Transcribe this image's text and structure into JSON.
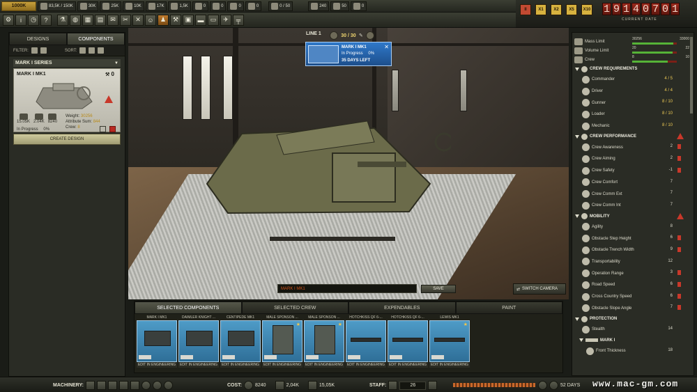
{
  "topbar": {
    "money": "1000K",
    "resources": [
      {
        "icon": "crate-icon",
        "value": "83,5K / 150K"
      },
      {
        "icon": "steel-icon",
        "value": "30K"
      },
      {
        "icon": "wood-icon",
        "value": "25K"
      },
      {
        "icon": "rubber-icon",
        "value": "10K"
      },
      {
        "icon": "oil-icon",
        "value": "17K"
      },
      {
        "icon": "coal-icon",
        "value": "1,5K"
      },
      {
        "icon": "tools-icon",
        "value": "0"
      },
      {
        "icon": "bullet-icon",
        "value": "0"
      },
      {
        "icon": "shell-icon",
        "value": "0"
      },
      {
        "icon": "fuel-icon",
        "value": "0"
      }
    ],
    "capacity": "0 / 50",
    "workers": [
      {
        "icon": "worker-icon",
        "value": "240"
      },
      {
        "icon": "engineer-icon",
        "value": "50"
      },
      {
        "icon": "pilot-icon",
        "value": "0"
      }
    ]
  },
  "date": {
    "digits": [
      "1",
      "9",
      "1",
      "4",
      "0",
      "7",
      "0",
      "1"
    ],
    "label": "CURRENT DATE",
    "speeds": [
      "II",
      "X1",
      "X2",
      "X5",
      "X10"
    ]
  },
  "left": {
    "tabs": [
      "DESIGNS",
      "COMPONENTS"
    ],
    "filter_label": "FILTER:",
    "sort_label": "SORT:",
    "series": "MARK I SERIES",
    "card": {
      "name": "MARK I MK1",
      "count": "0",
      "stats": [
        {
          "icon": "cost-icon",
          "value": "15.05K"
        },
        {
          "icon": "material-icon",
          "value": "2.04K"
        },
        {
          "icon": "gear-icon",
          "value": "8240"
        }
      ],
      "weight_label": "Weight:",
      "weight": "30256",
      "attr_label": "Attribute Sum:",
      "attr": "844",
      "crew_label": "Crew:",
      "crew": "8",
      "progress_label": "In Progress",
      "progress": "0%"
    },
    "create_button": "CREATE DESIGN"
  },
  "viewport": {
    "line_label": "LINE 1",
    "line_count": "30 / 30",
    "prod": {
      "name": "MARK I MK1",
      "status": "In Progress",
      "pct": "0%",
      "days": "35 DAYS LEFT"
    },
    "design_name": "MARK I MK1",
    "save": "SAVE",
    "switch_camera": "SWITCH CAMERA"
  },
  "bottom": {
    "tabs": [
      "SELECTED COMPONENTS",
      "SELECTED CREW",
      "EXPENDABLES",
      "PAINT"
    ],
    "components": [
      {
        "label": "MARK I MK1",
        "edit": "EDIT IN ENGINEERING"
      },
      {
        "label": "DAIMLER KNIGHT ...",
        "edit": "EDIT IN ENGINEERING"
      },
      {
        "label": "CENTIPEDE MK1",
        "edit": "EDIT IN ENGINEERING"
      },
      {
        "label": "MALE SPONSON ...",
        "edit": "EDIT IN ENGINEERING"
      },
      {
        "label": "MALE SPONSON ...",
        "edit": "EDIT IN ENGINEERING"
      },
      {
        "label": "HOTCHKISS QF 6-...",
        "edit": "EDIT IN ENGINEERING"
      },
      {
        "label": "HOTCHKISS QF 6-...",
        "edit": "EDIT IN ENGINEERING"
      },
      {
        "label": "LEWIS MK1",
        "edit": "EDIT IN ENGINEERING"
      }
    ]
  },
  "right": {
    "limits": [
      {
        "label": "Mass Limit",
        "value": "30256",
        "max": "33000",
        "fill": 0.92
      },
      {
        "label": "Volume Limit",
        "value": "20",
        "max": "22",
        "fill": 0.91
      },
      {
        "label": "Crew",
        "value": "8",
        "max": "10",
        "fill": 0.8
      }
    ],
    "sections": [
      {
        "title": "CREW REQUIREMENTS",
        "warn": false,
        "rows": [
          {
            "label": "Commander",
            "value": "4 / 5",
            "yellow": true,
            "warn": false
          },
          {
            "label": "Driver",
            "value": "4 / 4",
            "yellow": true,
            "warn": false
          },
          {
            "label": "Gunner",
            "value": "8 / 10",
            "yellow": true,
            "warn": false
          },
          {
            "label": "Loader",
            "value": "8 / 10",
            "yellow": true,
            "warn": false
          },
          {
            "label": "Mechanic",
            "value": "8 / 10",
            "yellow": true,
            "warn": false
          }
        ]
      },
      {
        "title": "CREW PERFORMANCE",
        "warn": true,
        "rows": [
          {
            "label": "Crew Awareness",
            "value": "2",
            "yellow": false,
            "warn": true
          },
          {
            "label": "Crew Aiming",
            "value": "2",
            "yellow": false,
            "warn": true
          },
          {
            "label": "Crew Safety",
            "value": "-1",
            "yellow": false,
            "warn": true
          },
          {
            "label": "Crew Comfort",
            "value": "7",
            "yellow": false,
            "warn": false
          },
          {
            "label": "Crew Comm Ext",
            "value": "7",
            "yellow": false,
            "warn": false
          },
          {
            "label": "Crew Comm Int",
            "value": "7",
            "yellow": false,
            "warn": false
          }
        ]
      },
      {
        "title": "MOBILITY",
        "warn": true,
        "rows": [
          {
            "label": "Agility",
            "value": "8",
            "yellow": false,
            "warn": false
          },
          {
            "label": "Obstacle Step Height",
            "value": "6",
            "yellow": false,
            "warn": true
          },
          {
            "label": "Obstacle Trench Width",
            "value": "9",
            "yellow": false,
            "warn": true
          },
          {
            "label": "Transportability",
            "value": "12",
            "yellow": false,
            "warn": false
          },
          {
            "label": "Operation Range",
            "value": "3",
            "yellow": false,
            "warn": true
          },
          {
            "label": "Road Speed",
            "value": "6",
            "yellow": false,
            "warn": true
          },
          {
            "label": "Cross Country Speed",
            "value": "6",
            "yellow": false,
            "warn": true
          },
          {
            "label": "Obstacle Slope Angle",
            "value": "7",
            "yellow": false,
            "warn": true
          }
        ]
      },
      {
        "title": "PROTECTION",
        "warn": false,
        "rows": [
          {
            "label": "Stealth",
            "value": "14",
            "yellow": false,
            "warn": false
          }
        ]
      }
    ],
    "sub_header": "MARK I",
    "sub_row": {
      "label": "Front Thickness",
      "value": "18"
    }
  },
  "status": {
    "machinery_label": "MACHINERY:",
    "cost_label": "COST:",
    "cost": "8240",
    "mat": "2,04K",
    "money": "15,05K",
    "staff_label": "STAFF:",
    "staff": "26",
    "days": "52 DAYS"
  },
  "watermark": "www.mac-gm.com"
}
